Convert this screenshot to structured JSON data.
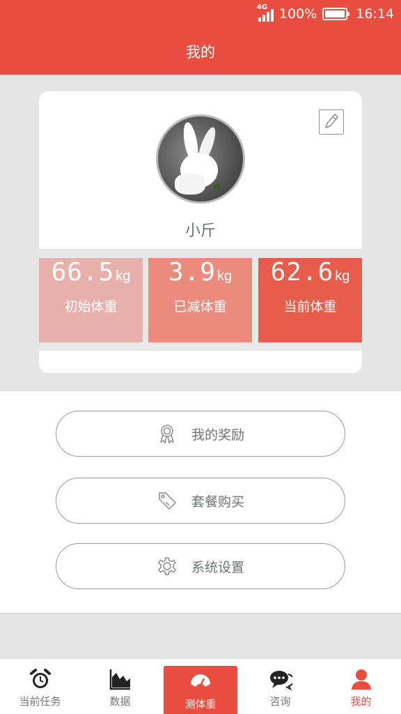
{
  "status_bar": {
    "network": "4G",
    "battery": "100%",
    "time": "16:14"
  },
  "header": {
    "title": "我的"
  },
  "profile": {
    "nickname": "小斤",
    "stats": [
      {
        "value": "66.5",
        "unit": "kg",
        "label": "初始体重"
      },
      {
        "value": "3.9",
        "unit": "kg",
        "label": "已减体重"
      },
      {
        "value": "62.6",
        "unit": "kg",
        "label": "当前体重"
      }
    ]
  },
  "menu": [
    {
      "label": "我的奖励",
      "icon": "award-ribbon-icon"
    },
    {
      "label": "套餐购买",
      "icon": "price-tag-icon"
    },
    {
      "label": "系统设置",
      "icon": "gear-icon"
    }
  ],
  "tabs": [
    {
      "label": "当前任务",
      "icon": "alarm-clock-icon"
    },
    {
      "label": "数据",
      "icon": "area-chart-icon"
    },
    {
      "label": "测体重",
      "icon": "scale-gauge-icon"
    },
    {
      "label": "咨询",
      "icon": "chat-bubbles-icon"
    },
    {
      "label": "我的",
      "icon": "person-icon"
    }
  ],
  "colors": {
    "brand": "#e84d3f",
    "stat1": "#e8b0aa",
    "stat2": "#ea8b7d",
    "stat3": "#e85c4c"
  }
}
